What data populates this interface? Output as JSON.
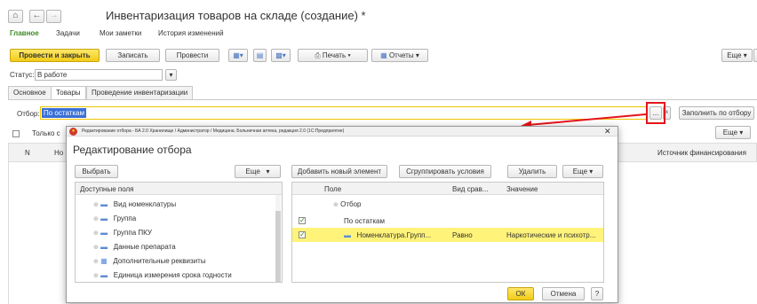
{
  "window": {
    "title": "Инвентаризация товаров на складе (создание) *"
  },
  "nav": {
    "home_icon": "home-icon",
    "back_icon": "arrow-left-icon",
    "forward_icon": "arrow-right-icon"
  },
  "sections": [
    "Главное",
    "Задачи",
    "Мои заметки",
    "История изменений"
  ],
  "toolbar": {
    "post_close": "Провести и закрыть",
    "save": "Записать",
    "post": "Провести",
    "print": "Печать",
    "reports": "Отчеты",
    "more": "Еще",
    "help": "?"
  },
  "status": {
    "label": "Статус:",
    "value": "В работе"
  },
  "tabs": [
    "Основное",
    "Товары",
    "Проведение инвентаризации"
  ],
  "filter": {
    "label": "Отбор:",
    "value": "По остаткам",
    "ellipsis": "...",
    "fill_button": "Заполнить по отбору"
  },
  "table_bar": {
    "only_label": "Только с",
    "more": "Еще"
  },
  "table": {
    "col_n": "N",
    "col_name": "Но",
    "col_source": "Источник финансирования"
  },
  "dialog": {
    "title_bar": "Редактирование отбора - БА 2.0 Хранилище / Администратор / Медицина. Больничная аптека, редакция 2.0 (1С:Предприятие)",
    "heading": "Редактирование отбора",
    "select_btn": "Выбрать",
    "more_left": "Еще",
    "add_btn": "Добавить новый элемент",
    "group_btn": "Сгруппировать условия",
    "delete_btn": "Удалить",
    "more_right": "Еще",
    "left_header": "Доступные поля",
    "fields": [
      "Вид номенклатуры",
      "Группа",
      "Группа ПКУ",
      "Данные препарата",
      "Дополнительные реквизиты",
      "Единица измерения срока годности"
    ],
    "right_headers": {
      "field": "Поле",
      "compare": "Вид срав...",
      "value": "Значение"
    },
    "root": "Отбор",
    "group": "По остаткам",
    "condition": {
      "field": "Номенклатура.Групп...",
      "compare": "Равно",
      "value": "Наркотические и психотр..."
    },
    "ok": "ОК",
    "cancel": "Отмена",
    "help": "?"
  },
  "colors": {
    "accent_green": "#3a8a1f",
    "highlight_yellow": "#fff37a",
    "annotation_red": "#e5141a",
    "button_yellow": "#f2cc17"
  }
}
